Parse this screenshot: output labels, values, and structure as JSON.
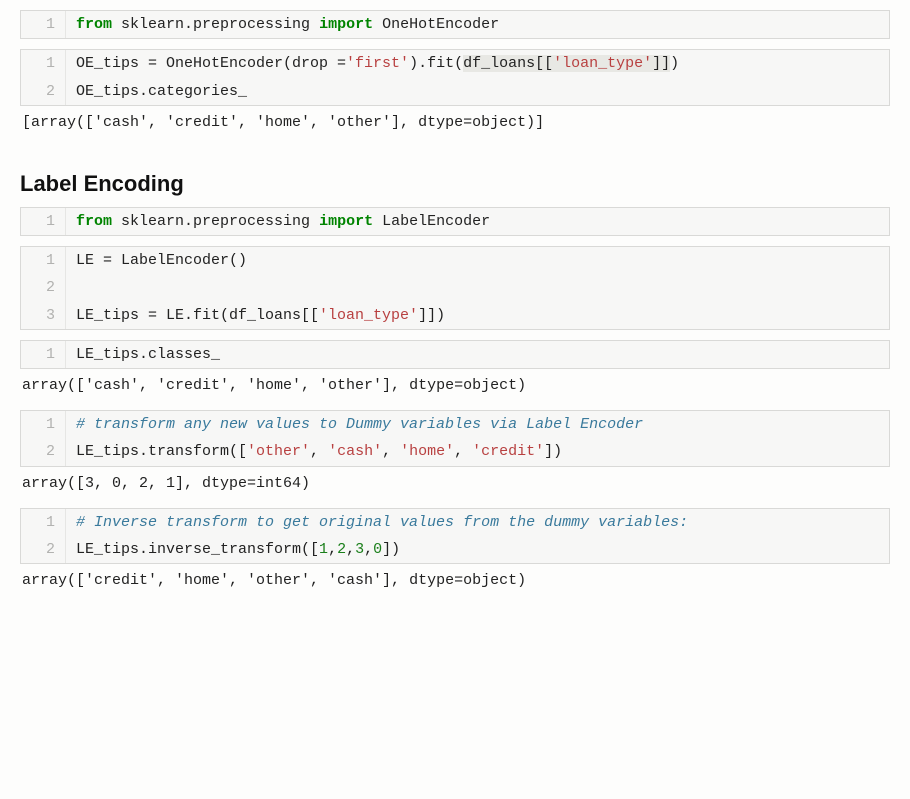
{
  "cells": [
    {
      "type": "code",
      "lines": [
        {
          "n": "1",
          "tokens": [
            {
              "t": "from ",
              "c": "kw-green"
            },
            {
              "t": "sklearn.preprocessing "
            },
            {
              "t": "import ",
              "c": "kw-green"
            },
            {
              "t": "OneHotEncoder"
            }
          ]
        }
      ]
    },
    {
      "type": "code",
      "lines": [
        {
          "n": "1",
          "tokens": [
            {
              "t": "OE_tips = OneHotEncoder(drop ="
            },
            {
              "t": "'first'",
              "c": "str-red"
            },
            {
              "t": ").fit("
            },
            {
              "t": "df_loans[[",
              "c": "hl"
            },
            {
              "t": "'loan_type'",
              "c": "str-red hl"
            },
            {
              "t": "]]",
              "c": "hl"
            },
            {
              "t": ")"
            }
          ]
        },
        {
          "n": "2",
          "tokens": [
            {
              "t": "OE_tips.categories_"
            }
          ]
        }
      ]
    },
    {
      "type": "output",
      "text": "[array(['cash', 'credit', 'home', 'other'], dtype=object)]"
    },
    {
      "type": "heading",
      "text": "Label Encoding"
    },
    {
      "type": "code",
      "lines": [
        {
          "n": "1",
          "tokens": [
            {
              "t": "from ",
              "c": "kw-green"
            },
            {
              "t": "sklearn.preprocessing "
            },
            {
              "t": "import ",
              "c": "kw-green"
            },
            {
              "t": "LabelEncoder"
            }
          ]
        }
      ]
    },
    {
      "type": "code",
      "lines": [
        {
          "n": "1",
          "tokens": [
            {
              "t": "LE = LabelEncoder()"
            }
          ]
        },
        {
          "n": "2",
          "tokens": [
            {
              "t": ""
            }
          ]
        },
        {
          "n": "3",
          "tokens": [
            {
              "t": "LE_tips = LE.fit(df_loans[["
            },
            {
              "t": "'loan_type'",
              "c": "str-red"
            },
            {
              "t": "]])"
            }
          ]
        }
      ]
    },
    {
      "type": "code",
      "lines": [
        {
          "n": "1",
          "tokens": [
            {
              "t": "LE_tips.classes_"
            }
          ]
        }
      ]
    },
    {
      "type": "output",
      "text": "array(['cash', 'credit', 'home', 'other'], dtype=object)"
    },
    {
      "type": "code",
      "lines": [
        {
          "n": "1",
          "tokens": [
            {
              "t": "# transform any new values to Dummy variables via Label Encoder",
              "c": "comment-it"
            }
          ]
        },
        {
          "n": "2",
          "tokens": [
            {
              "t": "LE_tips.transform(["
            },
            {
              "t": "'other'",
              "c": "str-red"
            },
            {
              "t": ", "
            },
            {
              "t": "'cash'",
              "c": "str-red"
            },
            {
              "t": ", "
            },
            {
              "t": "'home'",
              "c": "str-red"
            },
            {
              "t": ", "
            },
            {
              "t": "'credit'",
              "c": "str-red"
            },
            {
              "t": "])"
            }
          ]
        }
      ]
    },
    {
      "type": "output",
      "text": "array([3, 0, 2, 1], dtype=int64)"
    },
    {
      "type": "code",
      "lines": [
        {
          "n": "1",
          "tokens": [
            {
              "t": "# Inverse transform to get original values from the dummy variables:",
              "c": "comment-it"
            }
          ]
        },
        {
          "n": "2",
          "tokens": [
            {
              "t": "LE_tips.inverse_transform(["
            },
            {
              "t": "1",
              "c": "num-green"
            },
            {
              "t": ","
            },
            {
              "t": "2",
              "c": "num-green"
            },
            {
              "t": ","
            },
            {
              "t": "3",
              "c": "num-green"
            },
            {
              "t": ","
            },
            {
              "t": "0",
              "c": "num-green"
            },
            {
              "t": "])"
            }
          ]
        }
      ]
    },
    {
      "type": "output",
      "text": "array(['credit', 'home', 'other', 'cash'], dtype=object)"
    }
  ]
}
